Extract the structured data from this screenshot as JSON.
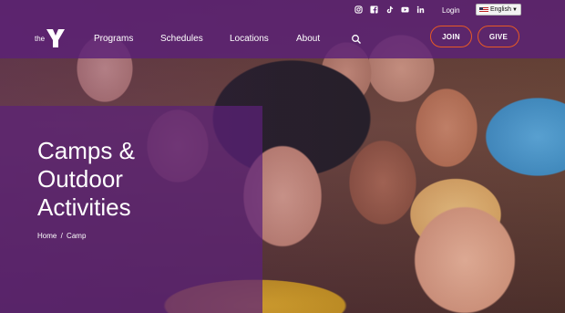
{
  "brand": {
    "the": "the",
    "logo_letter": "Y"
  },
  "utility": {
    "social": [
      "instagram-icon",
      "facebook-icon",
      "tiktok-icon",
      "youtube-icon",
      "linkedin-icon"
    ],
    "login": "Login",
    "language": "English"
  },
  "nav": {
    "items": [
      "Programs",
      "Schedules",
      "Locations",
      "About"
    ]
  },
  "actions": {
    "join": "JOIN",
    "give": "GIVE"
  },
  "hero": {
    "title_lines": [
      "Camps &",
      "Outdoor",
      "Activities"
    ],
    "breadcrumb": {
      "home": "Home",
      "separator": "/",
      "current": "Camp"
    }
  },
  "colors": {
    "purple": "#5c2178",
    "orange": "#e85a24",
    "white": "#ffffff"
  }
}
